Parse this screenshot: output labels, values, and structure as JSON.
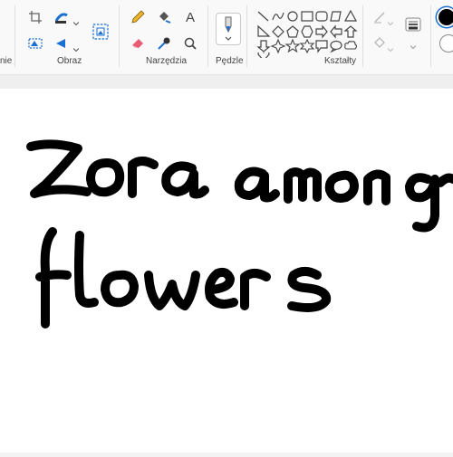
{
  "ribbon": {
    "groups": [
      {
        "name": "rysowanie_partial",
        "label": "nie"
      },
      {
        "name": "obraz",
        "label": "Obraz"
      },
      {
        "name": "narzedzia",
        "label": "Narzędzia"
      },
      {
        "name": "pedzle",
        "label": "Pędzle"
      },
      {
        "name": "ksztalty",
        "label": "Kształty"
      }
    ],
    "tools": {
      "text_tool_glyph": "A"
    }
  },
  "canvas": {
    "handwritten_text": [
      "Zora among",
      "flowers"
    ]
  },
  "colors": {
    "accent": "#1a6fd1",
    "ink": "#000000",
    "primary_color": "#000000",
    "secondary_color": "#ffffff"
  }
}
